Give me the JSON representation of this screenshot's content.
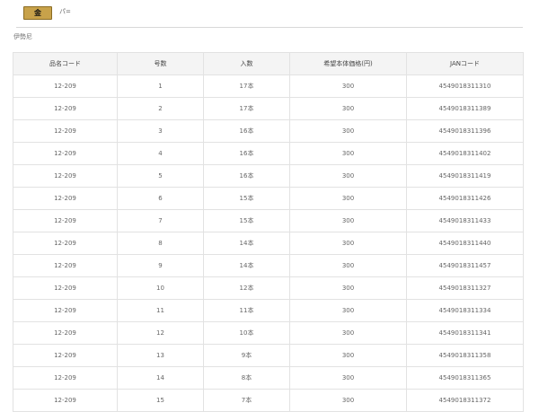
{
  "header": {
    "badge": "金",
    "label": "パ="
  },
  "product_name": "伊勢尼",
  "table": {
    "headers": [
      "品名コード",
      "号数",
      "入数",
      "希望本体価格(円)",
      "JANコード"
    ],
    "rows": [
      [
        "12-209",
        "1",
        "17本",
        "300",
        "4549018311310"
      ],
      [
        "12-209",
        "2",
        "17本",
        "300",
        "4549018311389"
      ],
      [
        "12-209",
        "3",
        "16本",
        "300",
        "4549018311396"
      ],
      [
        "12-209",
        "4",
        "16本",
        "300",
        "4549018311402"
      ],
      [
        "12-209",
        "5",
        "16本",
        "300",
        "4549018311419"
      ],
      [
        "12-209",
        "6",
        "15本",
        "300",
        "4549018311426"
      ],
      [
        "12-209",
        "7",
        "15本",
        "300",
        "4549018311433"
      ],
      [
        "12-209",
        "8",
        "14本",
        "300",
        "4549018311440"
      ],
      [
        "12-209",
        "9",
        "14本",
        "300",
        "4549018311457"
      ],
      [
        "12-209",
        "10",
        "12本",
        "300",
        "4549018311327"
      ],
      [
        "12-209",
        "11",
        "11本",
        "300",
        "4549018311334"
      ],
      [
        "12-209",
        "12",
        "10本",
        "300",
        "4549018311341"
      ],
      [
        "12-209",
        "13",
        "9本",
        "300",
        "4549018311358"
      ],
      [
        "12-209",
        "14",
        "8本",
        "300",
        "4549018311365"
      ],
      [
        "12-209",
        "15",
        "7本",
        "300",
        "4549018311372"
      ]
    ]
  }
}
